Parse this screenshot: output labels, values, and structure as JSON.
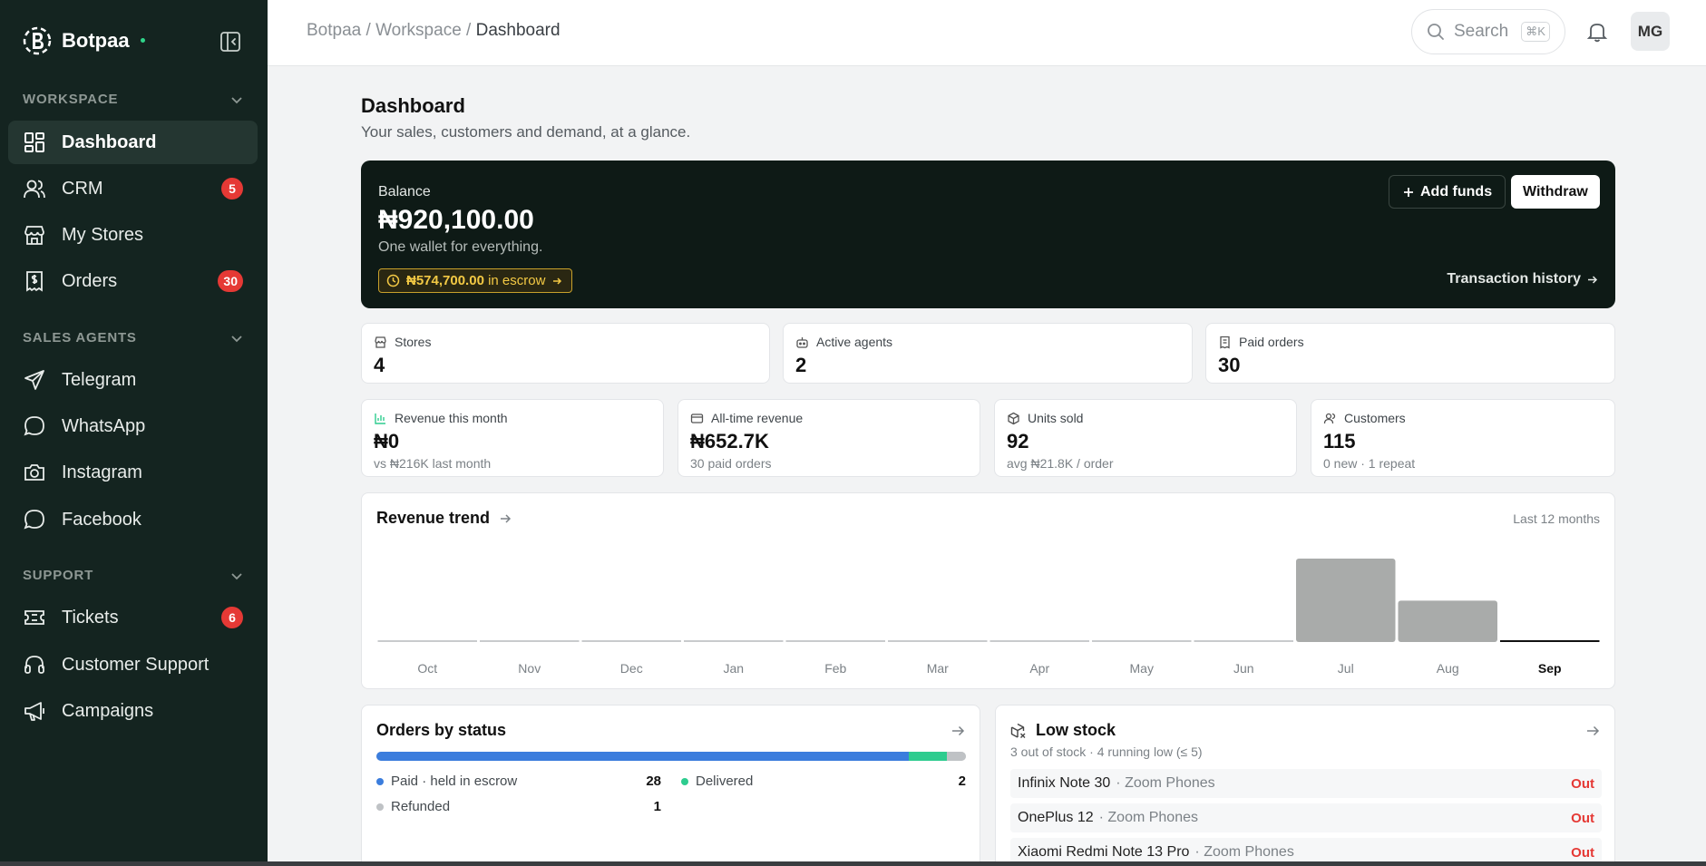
{
  "brand": {
    "name": "Botpaa"
  },
  "sidebar": {
    "sections": [
      {
        "title": "WORKSPACE",
        "items": [
          {
            "label": "Dashboard",
            "icon": "dashboard-icon"
          },
          {
            "label": "CRM",
            "icon": "users-icon",
            "badge": "5"
          },
          {
            "label": "My Stores",
            "icon": "store-icon"
          },
          {
            "label": "Orders",
            "icon": "receipt-icon",
            "badge": "30"
          }
        ]
      },
      {
        "title": "SALES AGENTS",
        "items": [
          {
            "label": "Telegram",
            "icon": "send-icon"
          },
          {
            "label": "WhatsApp",
            "icon": "chat-bubble-icon"
          },
          {
            "label": "Instagram",
            "icon": "camera-icon"
          },
          {
            "label": "Facebook",
            "icon": "chat-bubble-icon"
          }
        ]
      },
      {
        "title": "SUPPORT",
        "items": [
          {
            "label": "Tickets",
            "icon": "ticket-icon",
            "badge": "6"
          },
          {
            "label": "Customer Support",
            "icon": "headphones-icon"
          },
          {
            "label": "Campaigns",
            "icon": "megaphone-icon"
          }
        ]
      }
    ]
  },
  "topbar": {
    "breadcrumb": [
      "Botpaa",
      "Workspace",
      "Dashboard"
    ],
    "separator": "/",
    "search_placeholder": "Search",
    "search_shortcut": "⌘K",
    "avatar_initials": "MG"
  },
  "page": {
    "title": "Dashboard",
    "subtitle": "Your sales, customers and demand, at a glance."
  },
  "balance": {
    "label": "Balance",
    "value": "₦920,100.00",
    "subtitle": "One wallet for everything.",
    "escrow_amount": "₦574,700.00",
    "escrow_suffix": "in escrow",
    "add_funds_label": "Add funds",
    "withdraw_label": "Withdraw",
    "history_label": "Transaction history"
  },
  "stats_top": [
    {
      "label": "Stores",
      "value": "4",
      "icon": "store-icon"
    },
    {
      "label": "Active agents",
      "value": "2",
      "icon": "robot-icon"
    },
    {
      "label": "Paid orders",
      "value": "30",
      "icon": "receipt-icon"
    }
  ],
  "stats_bottom": [
    {
      "label": "Revenue this month",
      "value": "₦0",
      "sub": "vs ₦216K last month",
      "icon": "bar-chart-icon"
    },
    {
      "label": "All-time revenue",
      "value": "₦652.7K",
      "sub": "30 paid orders",
      "icon": "card-icon"
    },
    {
      "label": "Units sold",
      "value": "92",
      "sub": "avg ₦21.8K / order",
      "icon": "box-icon"
    },
    {
      "label": "Customers",
      "value": "115",
      "sub": "0 new · 1 repeat",
      "icon": "users-icon"
    }
  ],
  "revenue_trend": {
    "title": "Revenue trend",
    "range_label": "Last 12 months"
  },
  "chart_data": {
    "type": "bar",
    "categories": [
      "Oct",
      "Nov",
      "Dec",
      "Jan",
      "Feb",
      "Mar",
      "Apr",
      "May",
      "Jun",
      "Jul",
      "Aug",
      "Sep"
    ],
    "values": [
      0,
      0,
      0,
      0,
      0,
      0,
      0,
      0,
      0,
      436.5,
      216.2,
      0
    ],
    "highlight_category": "Sep",
    "bar_color": "#a9abaa",
    "highlight_color": "#111111"
  },
  "orders_by_status": {
    "title": "Orders by status",
    "items": [
      {
        "label": "Paid · held in escrow",
        "count": 28,
        "color": "#3b7ddd"
      },
      {
        "label": "Delivered",
        "count": 2,
        "color": "#2ecc8f"
      },
      {
        "label": "Refunded",
        "count": 1,
        "color": "#bfc2c5"
      }
    ]
  },
  "low_stock": {
    "title": "Low stock",
    "subtitle": "3 out of stock · 4 running low (≤ 5)",
    "items": [
      {
        "product": "Infinix Note 30",
        "store": "Zoom Phones",
        "status": "Out"
      },
      {
        "product": "OnePlus 12",
        "store": "Zoom Phones",
        "status": "Out"
      },
      {
        "product": "Xiaomi Redmi Note 13 Pro",
        "store": "Zoom Phones",
        "status": "Out"
      }
    ]
  },
  "colors": {
    "sidebar_bg": "#142420",
    "balance_bg": "#0e1a16",
    "badge": "#e53935",
    "escrow": "#f3c944",
    "accent_green": "#2fd58a"
  }
}
